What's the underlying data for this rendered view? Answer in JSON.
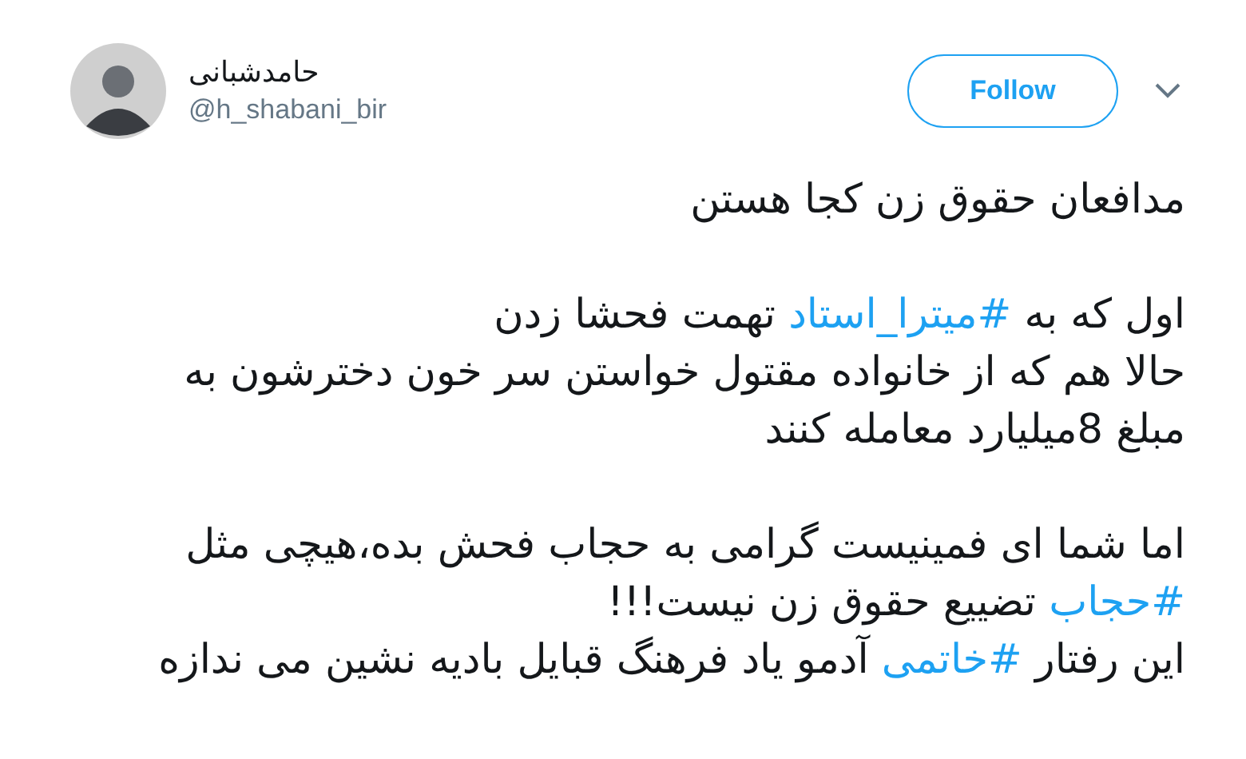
{
  "author": {
    "name": "حامدشبانی",
    "handle": "@h_shabani_bir"
  },
  "follow_button": {
    "label": "Follow"
  },
  "tweet": {
    "paragraphs": [
      {
        "lines": [
          [
            {
              "kind": "text",
              "text": "مدافعان حقوق زن کجا هستن"
            }
          ]
        ]
      },
      {
        "lines": [
          [
            {
              "kind": "text",
              "text": "اول که به "
            },
            {
              "kind": "hashtag",
              "text": "#میترا_استاد"
            },
            {
              "kind": "text",
              "text": " تهمت فحشا زدن"
            }
          ],
          [
            {
              "kind": "text",
              "text": "حالا هم که از خانواده مقتول خواستن سر خون دخترشون به"
            }
          ],
          [
            {
              "kind": "text",
              "text": "مبلغ 8میلیارد معامله کنند"
            }
          ]
        ]
      },
      {
        "lines": [
          [
            {
              "kind": "text",
              "text": "اما شما ای فمینیست گرامی به حجاب فحش بده،هیچی مثل"
            }
          ],
          [
            {
              "kind": "hashtag",
              "text": "#حجاب"
            },
            {
              "kind": "text",
              "text": " تضییع حقوق زن نیست!!!"
            }
          ],
          [
            {
              "kind": "text",
              "text": "این رفتار "
            },
            {
              "kind": "hashtag",
              "text": "#خاتمی"
            },
            {
              "kind": "text",
              "text": " آدمو یاد فرهنگ قبایل بادیه نشین می ندازه"
            }
          ]
        ]
      }
    ]
  }
}
